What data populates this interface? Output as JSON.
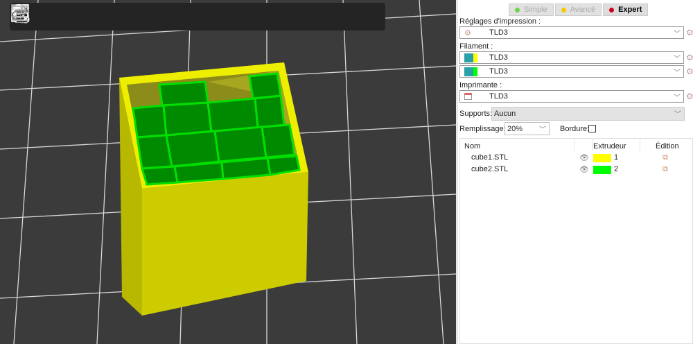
{
  "toolbar": {
    "buttons": [
      "add",
      "delete",
      "delete-all",
      "arrange",
      "copy",
      "paste",
      "add-instance",
      "remove-instance",
      "split-objects",
      "split-parts",
      "search",
      "layers-editing",
      "undo",
      "redo"
    ]
  },
  "modes": [
    {
      "label": "Simple",
      "color": "#6ed24a"
    },
    {
      "label": "Avancé",
      "color": "#f5c800"
    },
    {
      "label": "Expert",
      "color": "#d0021b"
    }
  ],
  "print_settings": {
    "label": "Réglages d'impression :",
    "value": "TLD3"
  },
  "filament": {
    "label": "Filament :",
    "values": [
      "TLD3",
      "TLD3"
    ],
    "colors": [
      "#ffff00",
      "#00ff00"
    ]
  },
  "printer": {
    "label": "Imprimante :",
    "value": "TLD3"
  },
  "supports": {
    "label": "Supports:",
    "value": "Aucun"
  },
  "infill": {
    "label": "Remplissage:",
    "value": "20%"
  },
  "brim": {
    "label": "Bordure:",
    "checked": false
  },
  "objects": {
    "headers": {
      "name": "Nom",
      "extruder": "Extrudeur",
      "edit": "Édition"
    },
    "rows": [
      {
        "name": "cube1.STL",
        "extruder": "1",
        "color": "#ffff00"
      },
      {
        "name": "cube2.STL",
        "extruder": "2",
        "color": "#00ff00"
      }
    ]
  }
}
